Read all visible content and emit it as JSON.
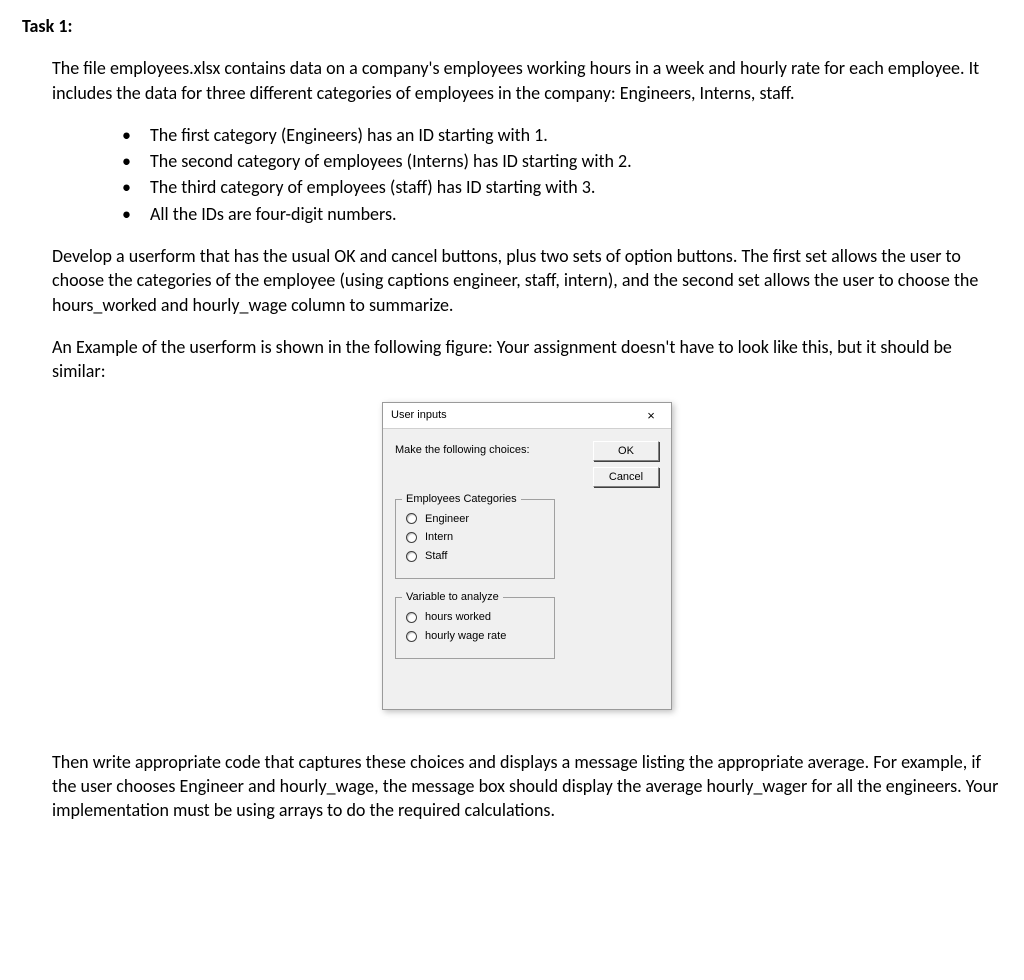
{
  "task_title": "Task 1:",
  "para1": "The file employees.xlsx contains data on a company's employees working hours in a week and hourly rate for each employee. It includes the data for three different categories of employees in the company: Engineers, Interns, staff.",
  "bullets": {
    "b1": "The first category (Engineers) has an ID starting with 1.",
    "b2": "The second category of employees (Interns) has ID starting with 2.",
    "b3": "The third category of employees (staff) has ID starting with 3.",
    "b4": "All the IDs are four-digit numbers."
  },
  "para2": "Develop a userform that has the usual OK and cancel buttons, plus two sets of option buttons. The first set allows the user to choose the categories of the employee (using captions engineer, staff, intern), and the second set allows the user to choose the hours_worked and hourly_wage column to summarize.",
  "para3": "An Example of the userform is shown in the following figure: Your assignment doesn't have to look like this, but it should be similar:",
  "para4": "Then write appropriate code that captures these choices and displays a message listing the appropriate average. For example, if the user chooses Engineer and hourly_wage, the message box should display the average hourly_wager for all the engineers. Your implementation must be using arrays to do the required calculations.",
  "dialog": {
    "title": "User inputs",
    "close_glyph": "×",
    "instruction": "Make the following choices:",
    "ok_label": "OK",
    "cancel_label": "Cancel",
    "group1": {
      "legend": "Employees Categories",
      "opt1": "Engineer",
      "opt2": "Intern",
      "opt3": "Staff"
    },
    "group2": {
      "legend": "Variable to analyze",
      "opt1": "hours worked",
      "opt2": "hourly wage rate"
    }
  }
}
